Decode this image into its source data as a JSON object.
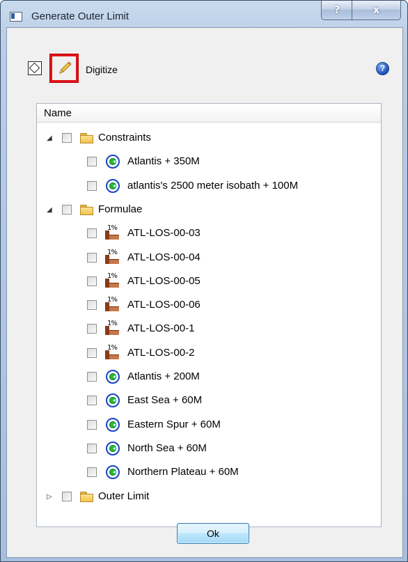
{
  "window": {
    "title": "Generate Outer Limit",
    "help_glyph": "?",
    "close_glyph": "x"
  },
  "toolbar": {
    "digitize_label": "Digitize",
    "help_glyph": "?"
  },
  "tree": {
    "header": "Name",
    "groups": [
      {
        "label": "Constraints",
        "expanded": true,
        "items": [
          {
            "label": "Atlantis + 350M",
            "icon": "constraint-icon"
          },
          {
            "label": "atlantis's 2500 meter isobath + 100M",
            "icon": "constraint-icon"
          }
        ]
      },
      {
        "label": "Formulae",
        "expanded": true,
        "items": [
          {
            "label": "ATL-LOS-00-03",
            "icon": "formula-icon"
          },
          {
            "label": "ATL-LOS-00-04",
            "icon": "formula-icon"
          },
          {
            "label": "ATL-LOS-00-05",
            "icon": "formula-icon"
          },
          {
            "label": "ATL-LOS-00-06",
            "icon": "formula-icon"
          },
          {
            "label": "ATL-LOS-00-1",
            "icon": "formula-icon"
          },
          {
            "label": "ATL-LOS-00-2",
            "icon": "formula-icon"
          },
          {
            "label": "Atlantis + 200M",
            "icon": "constraint-icon"
          },
          {
            "label": "East Sea + 60M",
            "icon": "constraint-icon"
          },
          {
            "label": "Eastern Spur + 60M",
            "icon": "constraint-icon"
          },
          {
            "label": "North Sea + 60M",
            "icon": "constraint-icon"
          },
          {
            "label": "Northern Plateau + 60M",
            "icon": "constraint-icon"
          }
        ]
      },
      {
        "label": "Outer Limit",
        "expanded": false,
        "items": []
      }
    ],
    "formula_icon_text": "1%"
  },
  "footer": {
    "ok_label": "Ok"
  }
}
